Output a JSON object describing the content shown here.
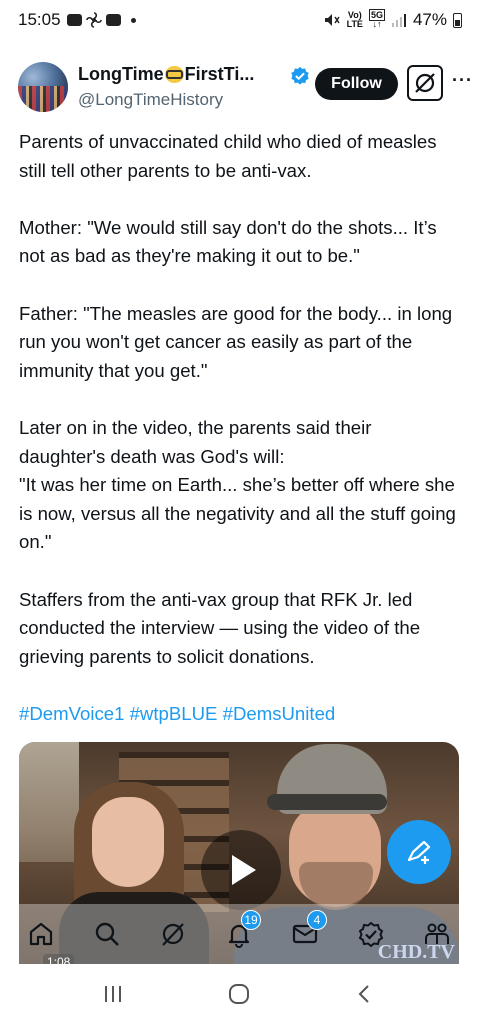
{
  "status_bar": {
    "time": "15:05",
    "network_top": "Vo)",
    "network_bottom": "LTE",
    "net5g_top": "5G",
    "battery": "47%"
  },
  "tweet": {
    "display_name_part1": "LongTime",
    "display_name_part2": "FirstTi...",
    "handle": "@LongTimeHistory",
    "follow_label": "Follow",
    "more_label": "···",
    "paragraphs": [
      "Parents of unvaccinated child who died of measles still tell other parents to be anti-vax.",
      "Mother: \"We would still say don't do the shots... It’s not as bad as they're making it out to be.\"",
      "Father: \"The measles are good for the body... in long run you won't get cancer as easily as part of the immunity that you get.\"",
      "Later on in the video, the parents said their daughter's death was God's will:",
      "\"It was her time on Earth... she’s better off where she is now, versus all the negativity and all the stuff going on.\"",
      "Staffers from the anti-vax group that RFK Jr. led conducted the interview — using the video of the grieving parents to solicit donations."
    ],
    "hashtags": "#DemVoice1 #wtpBLUE #DemsUnited",
    "video_duration": "1:08",
    "watermark": "CHD.TV"
  },
  "bottom_nav": {
    "notifications_badge": "19",
    "messages_badge": "4"
  },
  "colors": {
    "accent": "#1d9bf0",
    "text": "#0f1419",
    "secondary": "#536471"
  }
}
